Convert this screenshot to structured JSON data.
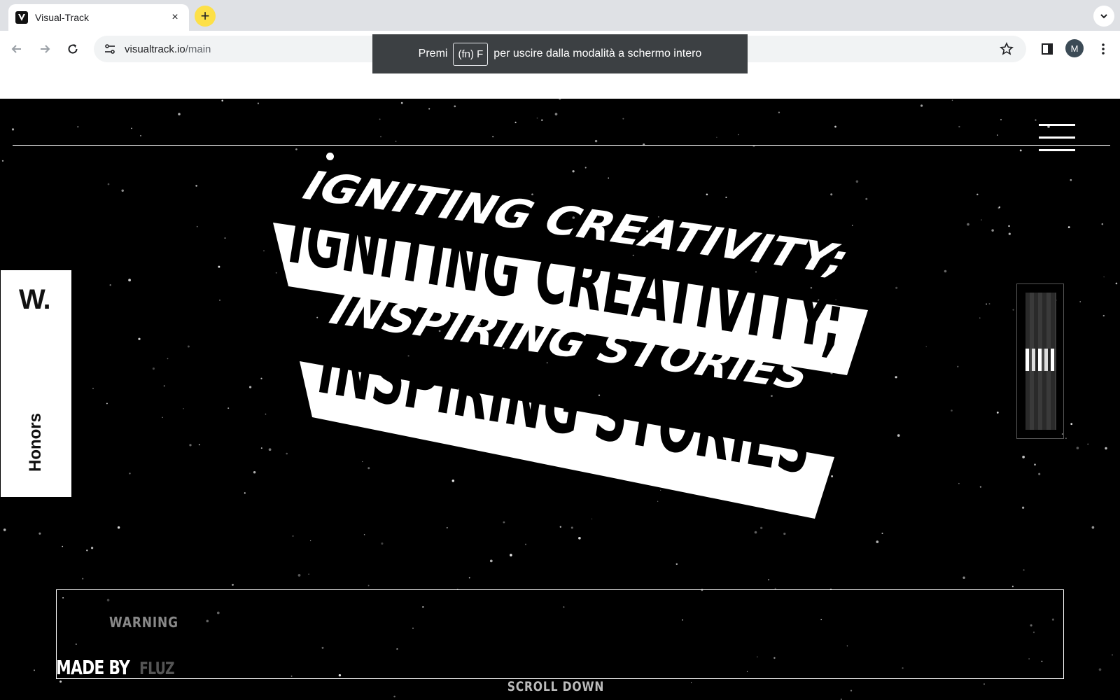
{
  "browser": {
    "tab_title": "Visual-Track",
    "tab_close": "×",
    "new_tab": "+",
    "url_host": "visualtrack.io",
    "url_path": "/main",
    "profile_initial": "M"
  },
  "fullscreen_toast": {
    "prefix": "Premi",
    "key": "(fn) F",
    "suffix": "per uscire dalla modalità a schermo intero"
  },
  "page": {
    "headline": {
      "line1": "IGNITING CREATIVITY;",
      "line2": "INSPIRING STORIES"
    },
    "honors": {
      "logo": "W.",
      "label": "Honors"
    },
    "footer": {
      "warning": "WARNING",
      "made_by": "MADE BY",
      "brand": "FLUZ",
      "scroll_down": "SCROLL DOWN"
    }
  },
  "colors": {
    "background": "#000000",
    "foreground": "#ffffff",
    "new_tab_accent": "#fde047",
    "toast": "#3c4043"
  }
}
